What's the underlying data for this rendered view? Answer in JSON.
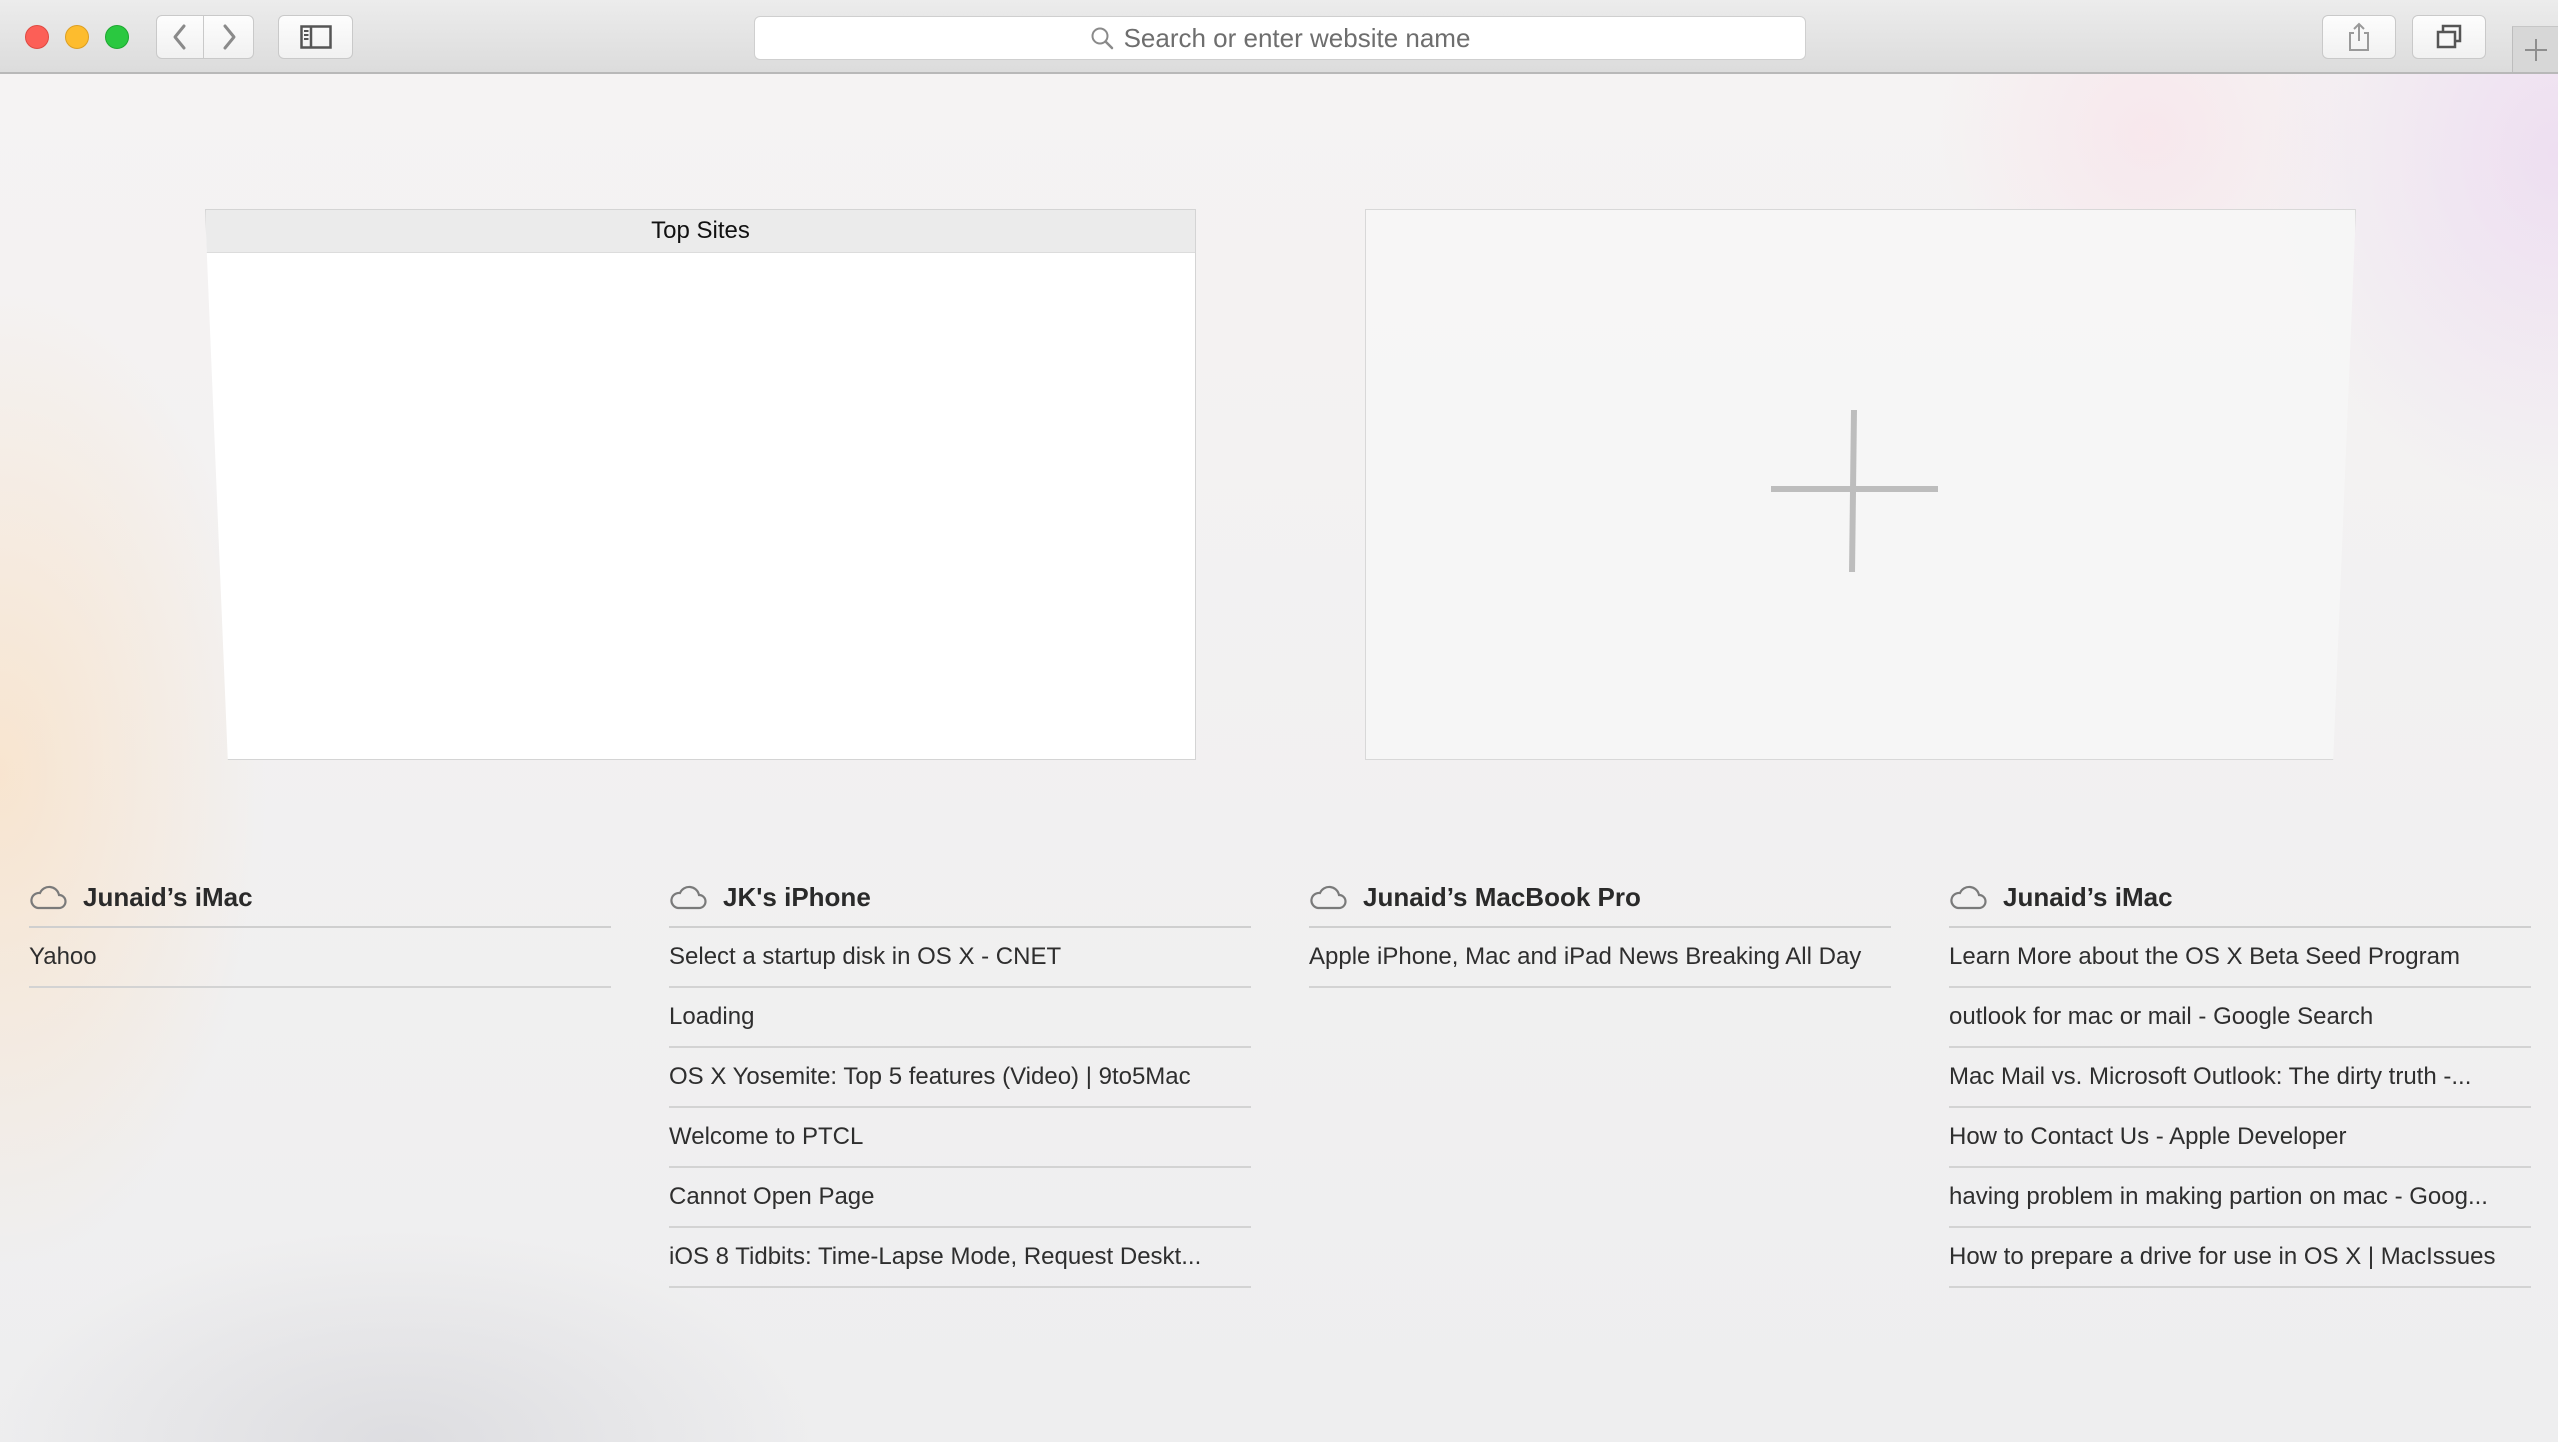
{
  "toolbar": {
    "address_placeholder": "Search or enter website name",
    "buttons": [
      "back-icon",
      "forward-icon",
      "sidebar-icon",
      "share-icon",
      "tabs-overview-icon",
      "new-tab-icon"
    ]
  },
  "top_sites": {
    "title": "Top Sites"
  },
  "columns": [
    {
      "device": "Junaid’s iMac",
      "items": [
        "Yahoo"
      ]
    },
    {
      "device": "JK's iPhone",
      "items": [
        "Select a startup disk in OS X - CNET",
        "Loading",
        "OS X Yosemite: Top 5 features (Video) | 9to5Mac",
        "Welcome to PTCL",
        "Cannot Open Page",
        "iOS 8 Tidbits: Time-Lapse Mode, Request Deskt..."
      ]
    },
    {
      "device": "Junaid’s MacBook Pro",
      "items": [
        "Apple iPhone, Mac and iPad News Breaking All Day"
      ]
    },
    {
      "device": "Junaid’s iMac",
      "items": [
        "Learn More about the OS X Beta Seed Program",
        "outlook for mac or mail - Google Search",
        "Mac Mail vs. Microsoft Outlook: The dirty truth -...",
        "How to Contact Us - Apple Developer",
        "having problem in making partion on mac - Goog...",
        "How to prepare a drive for use in OS X | MacIssues"
      ]
    }
  ]
}
